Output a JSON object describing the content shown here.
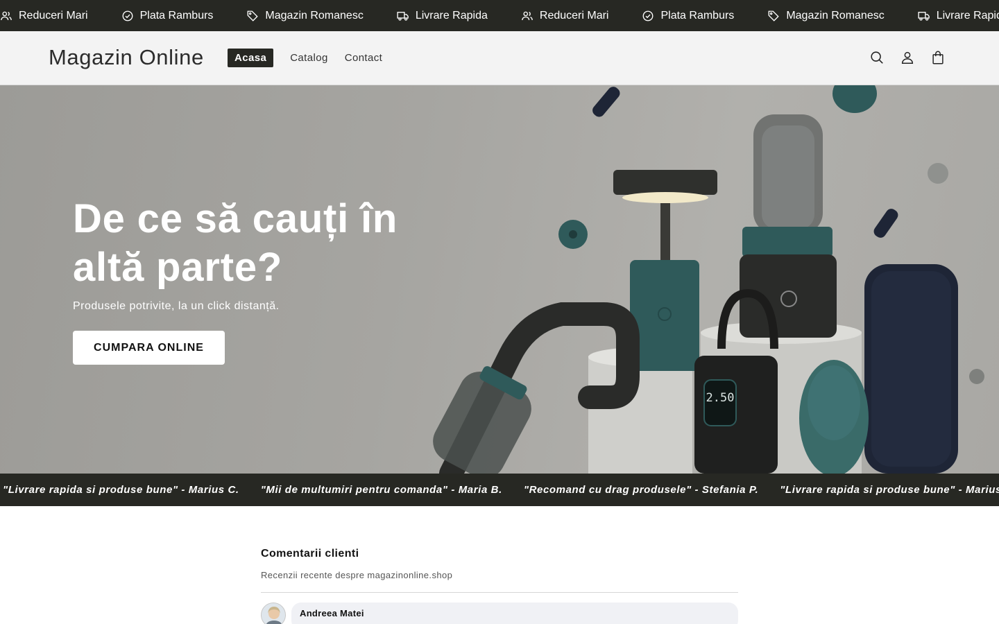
{
  "announcement": {
    "items": [
      {
        "icon": "users-icon",
        "label": "Reduceri Mari"
      },
      {
        "icon": "check-circle-icon",
        "label": "Plata Ramburs"
      },
      {
        "icon": "tag-icon",
        "label": "Magazin Romanesc"
      },
      {
        "icon": "truck-icon",
        "label": "Livrare Rapida"
      },
      {
        "icon": "users-icon",
        "label": "Reduceri Mari"
      },
      {
        "icon": "check-circle-icon",
        "label": "Plata Ramburs"
      },
      {
        "icon": "tag-icon",
        "label": "Magazin Romanesc"
      },
      {
        "icon": "truck-icon",
        "label": "Livrare Rapida"
      }
    ]
  },
  "header": {
    "logo": "Magazin Online",
    "nav": [
      {
        "label": "Acasa",
        "active": true
      },
      {
        "label": "Catalog",
        "active": false
      },
      {
        "label": "Contact",
        "active": false
      }
    ],
    "icons": [
      "search-icon",
      "account-icon",
      "cart-icon"
    ]
  },
  "hero": {
    "title": "De ce să cauți în altă parte?",
    "subtitle": "Produsele potrivite, la un click distanță.",
    "button": "CUMPARA ONLINE",
    "display_value": "2.50"
  },
  "testimonials": {
    "items": [
      "\"Livrare rapida si produse bune\" - Marius C.",
      "\"Mii de multumiri pentru comanda\" - Maria B.",
      "\"Recomand cu drag produsele\" - Stefania P.",
      "\"Livrare rapida si produse bune\" - Marius C."
    ]
  },
  "reviews": {
    "title": "Comentarii clienti",
    "subtitle": "Recenzii recente despre magazinonline.shop",
    "items": [
      {
        "author": "Andreea Matei"
      }
    ]
  },
  "colors": {
    "dark_bar": "#272823",
    "header_bg": "#f3f3f3",
    "teal": "#2f5a5a"
  }
}
